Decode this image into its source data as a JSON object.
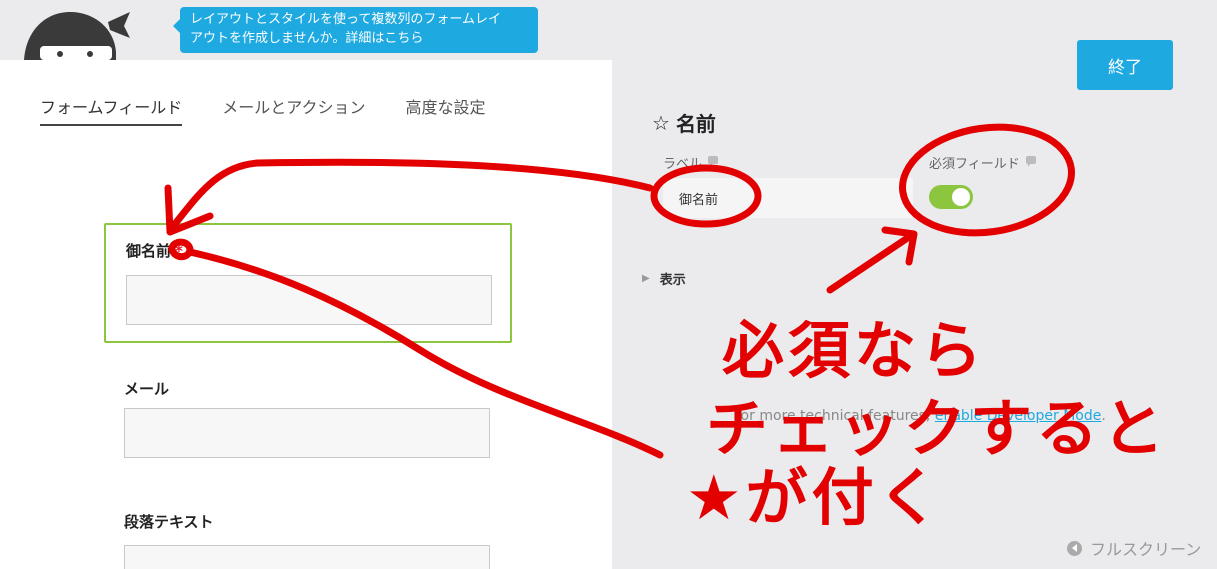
{
  "tooltip": {
    "line1": "レイアウトとスタイルを使って複数列のフォームレイ",
    "line2": "アウトを作成しませんか。詳細はこちら"
  },
  "tabs": [
    {
      "label": "フォームフィールド",
      "active": true
    },
    {
      "label": "メールとアクション",
      "active": false
    },
    {
      "label": "高度な設定",
      "active": false
    }
  ],
  "fields": [
    {
      "label": "御名前",
      "required_mark": "*"
    },
    {
      "label": "メール"
    },
    {
      "label": "段落テキスト"
    }
  ],
  "done_button": "終了",
  "settings": {
    "title": "名前",
    "star_icon": "☆",
    "label_caption": "ラベル",
    "label_value": "御名前",
    "required_caption": "必須フィールド",
    "required_on": true,
    "display_section": "表示"
  },
  "dev_note": {
    "text": "For more technical features, ",
    "link": "enable Developer Mode",
    "end": "."
  },
  "fullscreen": "フルスクリーン",
  "annotation": {
    "line1": "必須なら",
    "line2": "チェックすると",
    "line3": "★が付く"
  },
  "colors": {
    "accent": "#1ea9e1",
    "toggle_on": "#8cc63f",
    "annotation_red": "#e30000"
  }
}
